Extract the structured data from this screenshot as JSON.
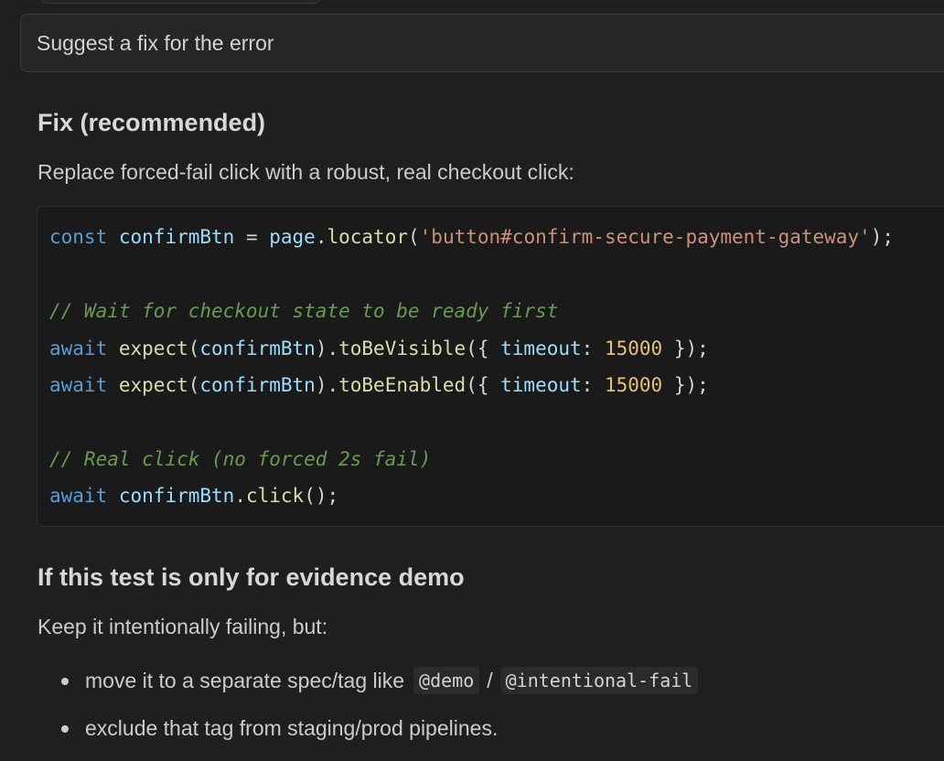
{
  "prompt": {
    "text": "Suggest a fix for the error"
  },
  "response": {
    "fix_heading": "Fix (recommended)",
    "fix_intro": "Replace forced-fail click with a robust, real checkout click:",
    "code": {
      "line1": {
        "kw": "const",
        "var": "confirmBtn",
        "eq": " = ",
        "obj": "page",
        "dot": ".",
        "fn": "locator",
        "open": "(",
        "str": "'button#confirm-secure-payment-gateway'",
        "close": ");"
      },
      "comment1": "// Wait for checkout state to be ready first",
      "line2": {
        "kw": "await",
        "fn": "expect",
        "open": "(",
        "arg": "confirmBtn",
        "mid": ").",
        "method": "toBeVisible",
        "brace_open": "({ ",
        "prop": "timeout",
        "colon": ": ",
        "num": "15000",
        "brace_close": " });"
      },
      "line3": {
        "kw": "await",
        "fn": "expect",
        "open": "(",
        "arg": "confirmBtn",
        "mid": ").",
        "method": "toBeEnabled",
        "brace_open": "({ ",
        "prop": "timeout",
        "colon": ": ",
        "num": "15000",
        "brace_close": " });"
      },
      "comment2": "// Real click (no forced 2s fail)",
      "line4": {
        "kw": "await",
        "var": "confirmBtn",
        "dot": ".",
        "fn": "click",
        "end": "();"
      }
    },
    "demo_heading": "If this test is only for evidence demo",
    "demo_intro": "Keep it intentionally failing, but:",
    "bullets": {
      "b1_text": "move it to a separate spec/tag like",
      "b1_code1": "@demo",
      "b1_slash": "/",
      "b1_code2": "@intentional-fail",
      "b2_text": "exclude that tag from staging/prod pipelines."
    }
  }
}
